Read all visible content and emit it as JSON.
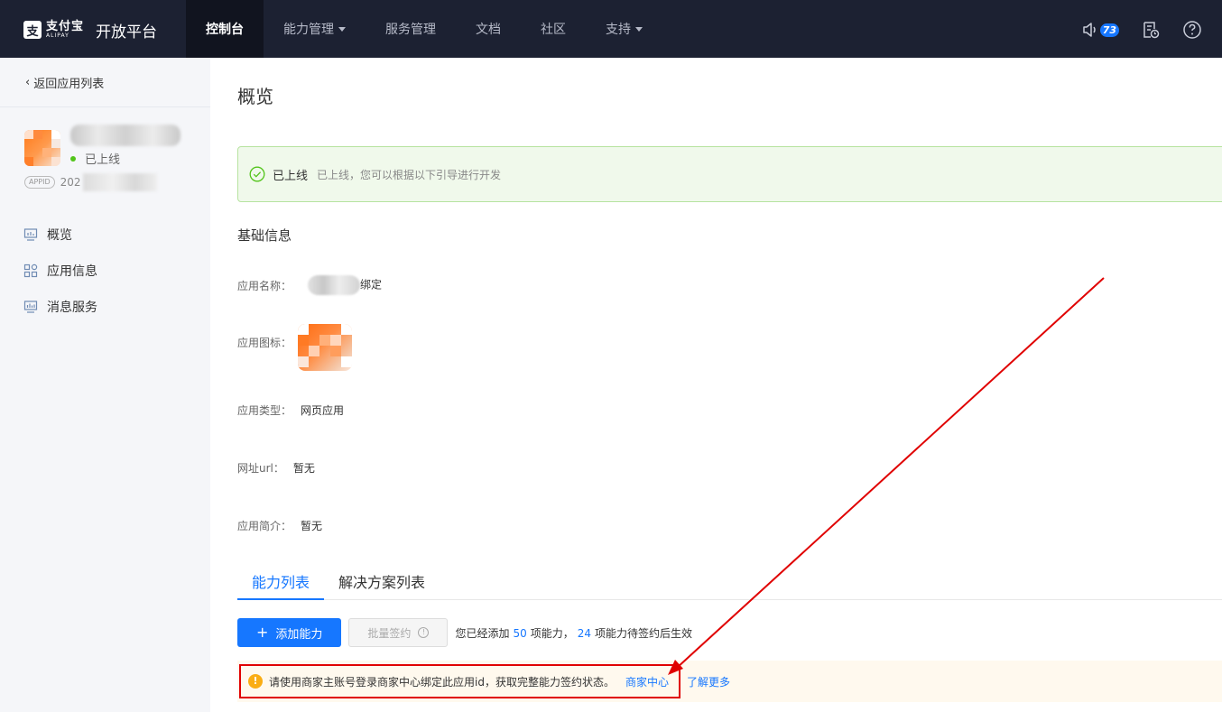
{
  "topbar": {
    "logo_cn": "支付宝",
    "logo_en": "ALIPAY",
    "platform": "开放平台",
    "nav": [
      {
        "label": "控制台",
        "active": true,
        "dropdown": false
      },
      {
        "label": "能力管理",
        "active": false,
        "dropdown": true
      },
      {
        "label": "服务管理",
        "active": false,
        "dropdown": false
      },
      {
        "label": "文档",
        "active": false,
        "dropdown": false
      },
      {
        "label": "社区",
        "active": false,
        "dropdown": false
      },
      {
        "label": "支持",
        "active": false,
        "dropdown": true
      }
    ],
    "notification_count": "73",
    "icons": [
      "speaker-icon",
      "document-clock-icon",
      "help-icon"
    ]
  },
  "sidebar": {
    "back_label": "返回应用列表",
    "app_status": "已上线",
    "appid_tag": "APPID",
    "appid_prefix": "202",
    "menu": [
      {
        "label": "概览",
        "icon": "monitor-icon"
      },
      {
        "label": "应用信息",
        "icon": "grid-icon"
      },
      {
        "label": "消息服务",
        "icon": "message-monitor-icon"
      }
    ]
  },
  "main": {
    "page_title": "概览",
    "status_alert": {
      "title": "已上线",
      "description": "已上线，您可以根据以下引导进行开发"
    },
    "section_title": "基础信息",
    "info": {
      "name_label": "应用名称：",
      "name_suffix": "绑定",
      "icon_label": "应用图标：",
      "type_label": "应用类型：",
      "type_value": "网页应用",
      "url_label": "网址url：",
      "url_value": "暂无",
      "intro_label": "应用简介：",
      "intro_value": "暂无"
    },
    "tabs": [
      {
        "label": "能力列表",
        "active": true
      },
      {
        "label": "解决方案列表",
        "active": false
      }
    ],
    "toolbar": {
      "add_label": "添加能力",
      "batch_label": "批量签约",
      "summary_prefix": "您已经添加",
      "added_count": "50",
      "summary_mid": "项能力，",
      "pending_count": "24",
      "summary_suffix": "项能力待签约后生效"
    },
    "warning": {
      "text": "请使用商家主账号登录商家中心绑定此应用id，获取完整能力签约状态。",
      "link": "商家中心",
      "learn_more": "了解更多"
    }
  },
  "colors": {
    "topbar_bg": "#1c2132",
    "primary": "#1677ff",
    "success": "#52c41a",
    "warning": "#faad14",
    "highlight_red": "#e00000"
  }
}
